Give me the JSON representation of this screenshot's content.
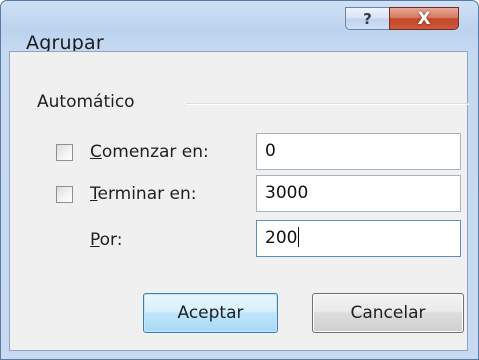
{
  "window": {
    "title": "Agrupar",
    "help_glyph": "?",
    "close_glyph": "X"
  },
  "group": {
    "title": "Automático"
  },
  "fields": [
    {
      "label_first": "C",
      "label_rest": "omenzar en:",
      "value": "0",
      "checked": false
    },
    {
      "label_first": "T",
      "label_rest": "erminar en:",
      "value": "3000",
      "checked": false
    },
    {
      "label_first": "P",
      "label_rest": "or:",
      "value": "200"
    }
  ],
  "buttons": {
    "ok": "Aceptar",
    "cancel": "Cancelar"
  },
  "colors": {
    "close_button": "#c2462a",
    "client_background": "#f0f0f0",
    "frame": "#c5d9f1"
  }
}
